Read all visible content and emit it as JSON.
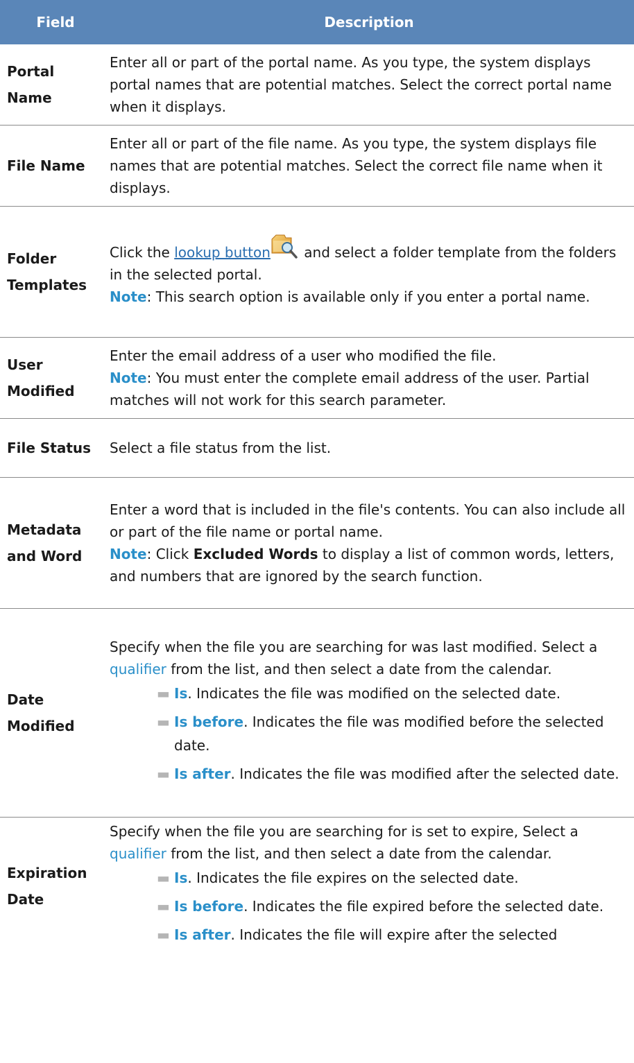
{
  "header": {
    "field": "Field",
    "description": "Description"
  },
  "rows": {
    "portal": {
      "field": "Portal Name",
      "desc": "Enter all or part of the portal name. As you type, the system displays portal names that are potential matches. Select the correct portal name when it displays."
    },
    "file": {
      "field": "File Name",
      "desc": "Enter all or part of the file name. As you type, the system displays file names that are potential matches. Select the correct file name when it displays."
    },
    "folder": {
      "field": "Folder Templates",
      "click": "Click the ",
      "link": "lookup button",
      "after": " and select a folder template from the folders in the selected portal.",
      "note_label": "Note",
      "note_text": ": This search option is available only if you enter a portal name."
    },
    "user": {
      "field": "User Modified",
      "desc": "Enter the email address of a user who modified the file.",
      "note_label": "Note",
      "note_text": ": You must enter the complete email address of the user. Partial matches will not work for this search parameter."
    },
    "status": {
      "field": "File Status",
      "desc": "Select a file status from the list."
    },
    "meta": {
      "field": "Metadata and Word",
      "desc": "Enter a word that is included in the file's contents. You can also include all or part of the file name or portal name.",
      "note_label": "Note",
      "note_pre": ": Click ",
      "note_bold": "Excluded Words",
      "note_post": " to display a list of common words, letters, and numbers that are ignored by the search function."
    },
    "date_modified": {
      "field": "Date Modified",
      "intro1": "Specify when the file you are searching for was last modified. Select a ",
      "qualifier": "qualifier",
      "intro2": " from the list, and then select a date from the calendar.",
      "items": [
        {
          "kw": "Is",
          "text": ". Indicates the file was modified on the selected date."
        },
        {
          "kw": "Is before",
          "text": ". Indicates the file was modified before the selected date."
        },
        {
          "kw": "Is after",
          "text": ". Indicates the file was modified after the selected date."
        }
      ]
    },
    "expiration": {
      "field": "Expiration Date",
      "intro1": "Specify when the file you are searching for is set to expire, Select a ",
      "qualifier": "qualifier",
      "intro2": " from the list, and then select a date from the calendar.",
      "items": [
        {
          "kw": "Is",
          "text": ". Indicates the file expires on the selected date."
        },
        {
          "kw": "Is before",
          "text": ". Indicates the file expired before the selected date."
        },
        {
          "kw": "Is after",
          "text": ". Indicates the file will expire after the selected"
        }
      ]
    }
  },
  "icons": {
    "lookup": "lookup-folder-search-icon",
    "bullet": "dash-bullet"
  },
  "colors": {
    "header_bg": "#5a86b8",
    "note": "#2a8fc9",
    "link": "#2a6eb0"
  }
}
